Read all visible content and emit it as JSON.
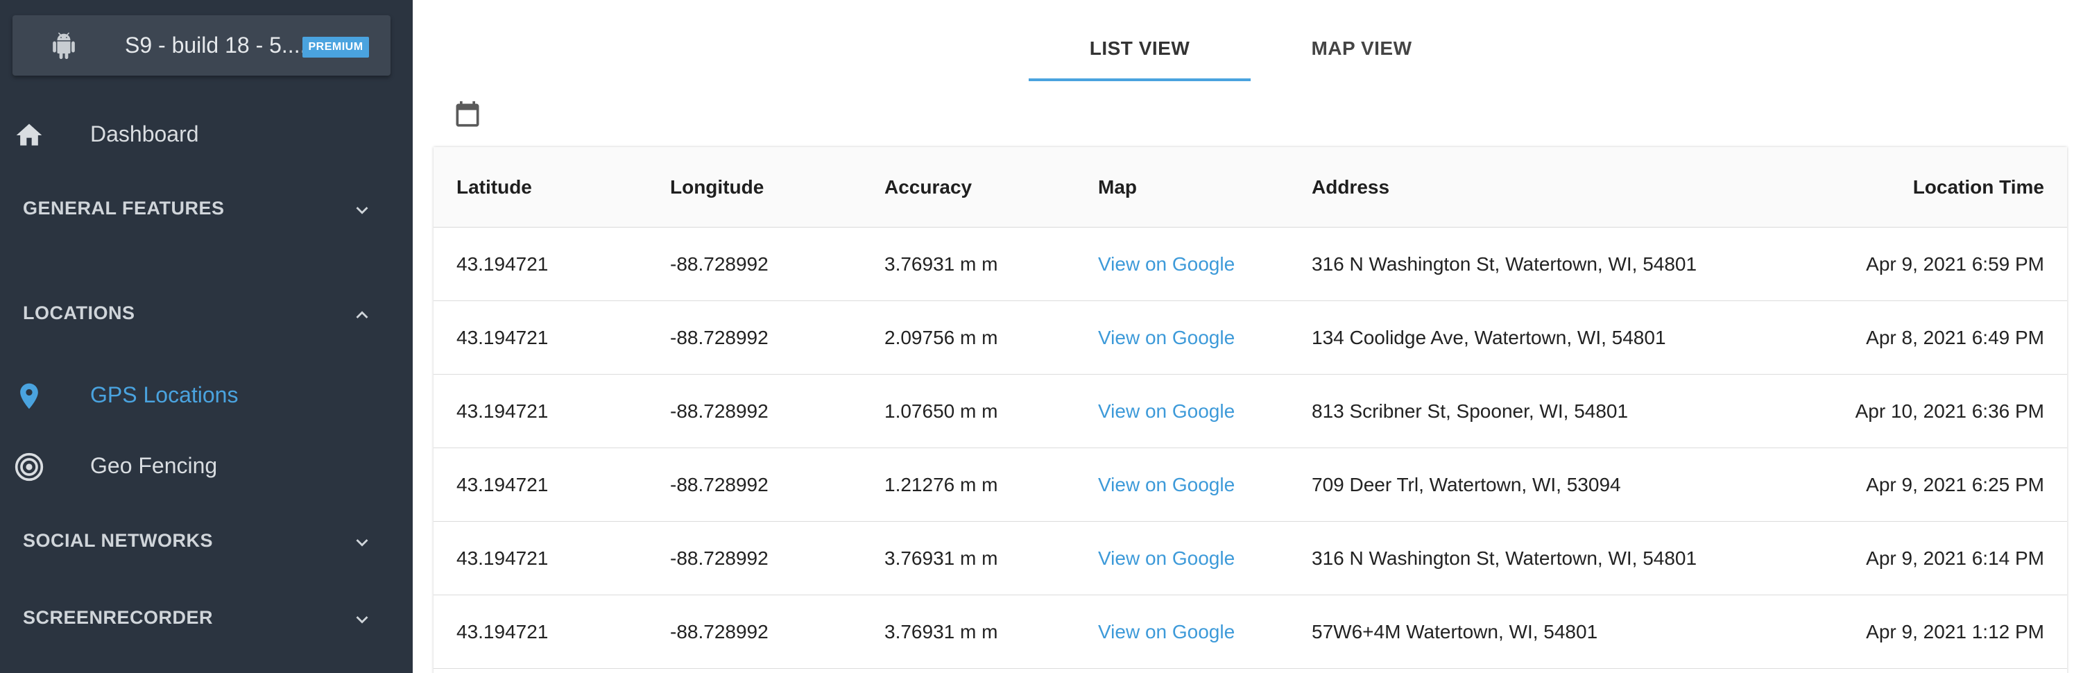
{
  "device": {
    "name": "S9 - build 18 - 5....",
    "badge": "PREMIUM"
  },
  "sidebar": {
    "dashboard": "Dashboard",
    "sections": {
      "general": "GENERAL FEATURES",
      "locations": "LOCATIONS",
      "social": "SOCIAL NETWORKS",
      "screenrecorder": "SCREENRECORDER"
    },
    "items": {
      "gps": "GPS Locations",
      "geofencing": "Geo Fencing"
    },
    "icons": [
      "android-icon",
      "home-icon",
      "location-pin-icon",
      "target-icon",
      "chevron-down-icon",
      "chevron-up-icon"
    ],
    "accent_color": "#4aa3df",
    "background_color": "#2b3440"
  },
  "tabs": {
    "list": "LIST VIEW",
    "map": "MAP VIEW",
    "active": "LIST VIEW"
  },
  "table": {
    "headers": {
      "latitude": "Latitude",
      "longitude": "Longitude",
      "accuracy": "Accuracy",
      "map": "Map",
      "address": "Address",
      "time": "Location Time"
    },
    "rows": [
      {
        "latitude": "43.194721",
        "longitude": "-88.728992",
        "accuracy": "3.76931 m m",
        "map": "View on Google",
        "address": "316 N Washington St, Watertown, WI, 54801",
        "time": "Apr 9, 2021 6:59 PM"
      },
      {
        "latitude": "43.194721",
        "longitude": "-88.728992",
        "accuracy": "2.09756 m m",
        "map": "View on Google",
        "address": "134 Coolidge Ave, Watertown, WI, 54801",
        "time": "Apr 8, 2021 6:49 PM"
      },
      {
        "latitude": "43.194721",
        "longitude": "-88.728992",
        "accuracy": "1.07650 m m",
        "map": "View on Google",
        "address": "813 Scribner St, Spooner, WI, 54801",
        "time": "Apr 10, 2021 6:36 PM"
      },
      {
        "latitude": "43.194721",
        "longitude": "-88.728992",
        "accuracy": "1.21276 m m",
        "map": "View on Google",
        "address": "709 Deer Trl, Watertown, WI, 53094",
        "time": "Apr 9, 2021 6:25 PM"
      },
      {
        "latitude": "43.194721",
        "longitude": "-88.728992",
        "accuracy": "3.76931 m m",
        "map": "View on Google",
        "address": "316 N Washington St, Watertown, WI, 54801",
        "time": "Apr 9, 2021 6:14 PM"
      },
      {
        "latitude": "43.194721",
        "longitude": "-88.728992",
        "accuracy": "3.76931 m m",
        "map": "View on Google",
        "address": "57W6+4M Watertown, WI, 54801",
        "time": "Apr 9, 2021 1:12 PM"
      }
    ]
  }
}
